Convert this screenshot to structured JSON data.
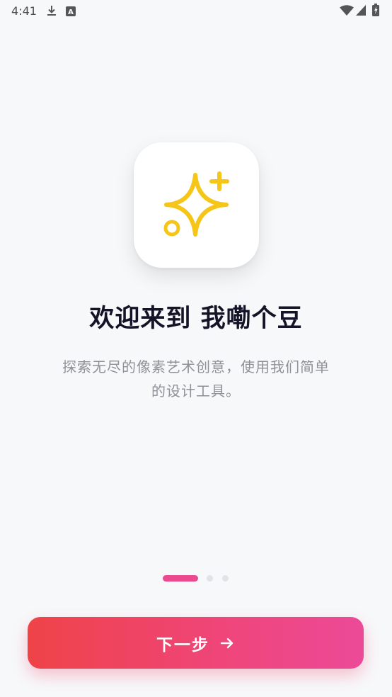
{
  "status_bar": {
    "time": "4:41",
    "icons": [
      "download-icon",
      "text-a-icon",
      "wifi-icon",
      "signal-icon",
      "battery-icon"
    ]
  },
  "app_icon": {
    "name": "sparkle-icon",
    "color": "#f5c518"
  },
  "welcome": {
    "title": "欢迎来到 我嘞个豆",
    "subtitle": "探索无尽的像素艺术创意，使用我们简单的设计工具。"
  },
  "pagination": {
    "active_index": 0,
    "count": 3,
    "active_color": "#ec4a8e"
  },
  "next_button": {
    "label": "下一步",
    "icon": "arrow-right-icon"
  },
  "colors": {
    "background": "#f7f8fa",
    "button_gradient_start": "#ef4348",
    "button_gradient_end": "#ec4a98"
  }
}
